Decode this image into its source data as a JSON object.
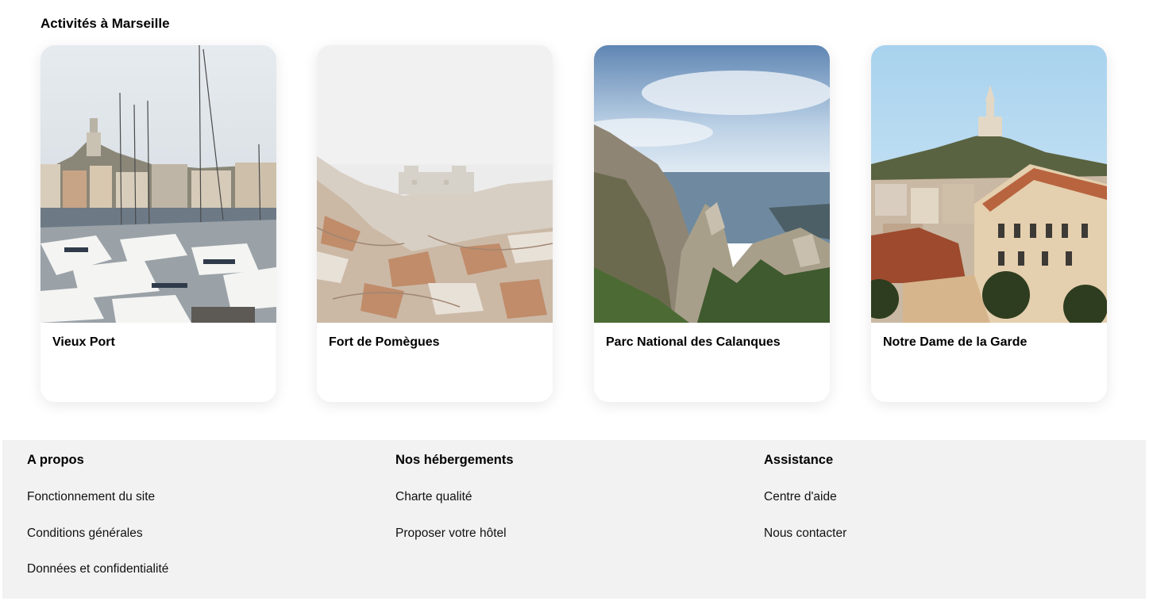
{
  "activities": {
    "title": "Activités à Marseille",
    "cards": [
      {
        "name": "Vieux Port",
        "photo_icon": "harbor-photo"
      },
      {
        "name": "Fort de Pomègues",
        "photo_icon": "fort-photo"
      },
      {
        "name": "Parc National des Calanques",
        "photo_icon": "calanques-photo"
      },
      {
        "name": "Notre Dame de la Garde",
        "photo_icon": "basilica-photo"
      }
    ]
  },
  "footer": {
    "columns": [
      {
        "title": "A propos",
        "links": [
          "Fonctionnement du site",
          "Conditions générales",
          "Données et confidentialité"
        ]
      },
      {
        "title": "Nos hébergements",
        "links": [
          "Charte qualité",
          "Proposer votre hôtel"
        ]
      },
      {
        "title": "Assistance",
        "links": [
          "Centre d'aide",
          "Nous contacter"
        ]
      }
    ]
  },
  "colors": {
    "footer_bg": "#f2f2f2",
    "card_bg": "#ffffff",
    "text": "#000000"
  }
}
